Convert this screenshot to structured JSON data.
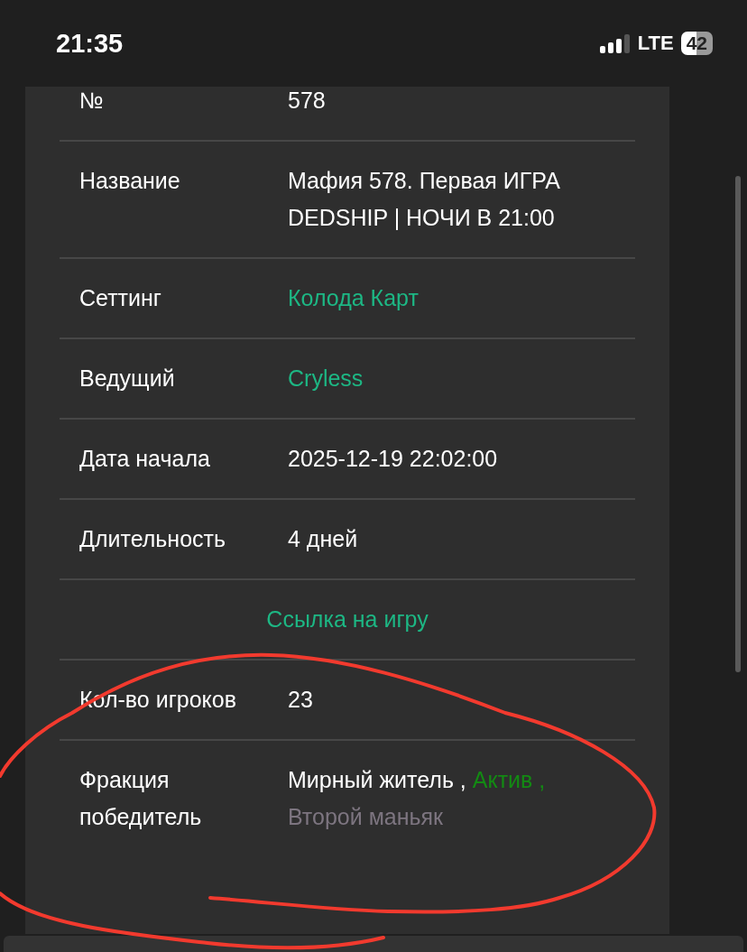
{
  "status_bar": {
    "time": "21:35",
    "network": "LTE",
    "battery": "42"
  },
  "rows": [
    {
      "kind": "text",
      "label": "№",
      "value": "578"
    },
    {
      "kind": "text",
      "label": "Название",
      "value": "Мафия 578. Первая ИГРА DEDSHIP | НОЧИ В 21:00"
    },
    {
      "kind": "link",
      "label": "Сеттинг",
      "value": "Колода Карт"
    },
    {
      "kind": "link",
      "label": "Ведущий",
      "value": "Cryless"
    },
    {
      "kind": "text",
      "label": "Дата начала",
      "value": "2025-12-19 22:02:00"
    },
    {
      "kind": "text",
      "label": "Длительность",
      "value": "4 дней"
    },
    {
      "kind": "wide_link",
      "value": "Ссылка на игру"
    },
    {
      "kind": "text",
      "label": "Кол-во игроков",
      "value": "23"
    },
    {
      "kind": "factions",
      "label": "Фракция победитель",
      "items": [
        {
          "text": "Мирный житель ,",
          "color": "#ffffff"
        },
        {
          "text": "Актив ,",
          "color": "#138a13"
        },
        {
          "text": "Второй маньяк",
          "color": "#7d7580"
        }
      ]
    }
  ]
}
